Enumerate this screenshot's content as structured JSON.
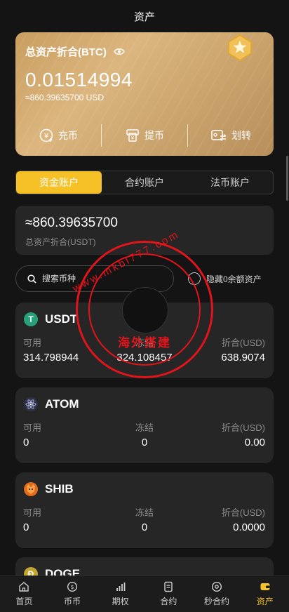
{
  "header": {
    "title": "资产"
  },
  "summary": {
    "title": "总资产折合(BTC)",
    "btc_value": "0.01514994",
    "usd_value": "≈860.39635700 USD",
    "actions": [
      {
        "label": "充币",
        "icon": "deposit-icon"
      },
      {
        "label": "提币",
        "icon": "withdraw-icon"
      },
      {
        "label": "划转",
        "icon": "transfer-icon"
      }
    ]
  },
  "tabs": [
    "资金账户",
    "合约账户",
    "法币账户"
  ],
  "active_tab": "资金账户",
  "total": {
    "value": "≈860.39635700",
    "label": "总资产折合(USDT)"
  },
  "search": {
    "placeholder": "搜索币种"
  },
  "hide_zero": {
    "label": "隐藏0余额资产"
  },
  "column_labels": {
    "available": "可用",
    "frozen": "冻结",
    "converted": "折合(USD)"
  },
  "assets": [
    {
      "symbol": "USDT",
      "available": "314.798944",
      "frozen": "324.108457",
      "converted": "638.9074",
      "color": "#26a17b"
    },
    {
      "symbol": "ATOM",
      "available": "0",
      "frozen": "0",
      "converted": "0.00",
      "color": "#2e3148"
    },
    {
      "symbol": "SHIB",
      "available": "0",
      "frozen": "0",
      "converted": "0.0000",
      "color": "#e46a1b"
    },
    {
      "symbol": "DOGE",
      "color": "#c2a633"
    }
  ],
  "nav": [
    {
      "label": "首页",
      "icon": "home-icon"
    },
    {
      "label": "币币",
      "icon": "coin-icon"
    },
    {
      "label": "期权",
      "icon": "chart-bars-icon"
    },
    {
      "label": "合约",
      "icon": "document-icon"
    },
    {
      "label": "秒合约",
      "icon": "target-icon"
    },
    {
      "label": "资产",
      "icon": "wallet-icon"
    }
  ],
  "active_nav": "资产",
  "watermark": {
    "text": "海外搭建",
    "arc_text": "www.mkbl777.com"
  }
}
